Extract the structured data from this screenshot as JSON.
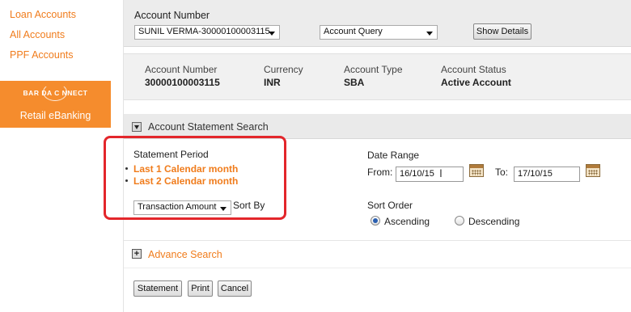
{
  "sidebar": {
    "links": [
      "Loan Accounts",
      "All Accounts",
      "PPF Accounts"
    ],
    "brand_logo": "BAR DA C NNECT",
    "brand_sub": "Retail eBanking"
  },
  "account_bar": {
    "label": "Account Number",
    "account_select": "SUNIL VERMA-30000100003115",
    "query_select": "Account Query",
    "show_details": "Show Details"
  },
  "summary": [
    {
      "header": "Account Number",
      "value": "30000100003115"
    },
    {
      "header": "Currency",
      "value": "INR"
    },
    {
      "header": "Account Type",
      "value": "SBA"
    },
    {
      "header": "Account Status",
      "value": "Active Account"
    }
  ],
  "statement_search": {
    "title": "Account Statement Search",
    "period_label": "Statement Period",
    "period_options": [
      "Last 1 Calendar month",
      "Last 2 Calendar month"
    ],
    "sort_field": "Transaction Amount",
    "sort_by_label": "Sort By",
    "date_range_label": "Date Range",
    "from_label": "From:",
    "from_value": "16/10/15",
    "to_label": "To:",
    "to_value": "17/10/15",
    "sort_order_label": "Sort Order",
    "sort_orders": [
      {
        "label": "Ascending",
        "selected": true
      },
      {
        "label": "Descending",
        "selected": false
      }
    ]
  },
  "advance_search": {
    "icon": "+",
    "label": "Advance Search"
  },
  "buttons": {
    "statement": "Statement",
    "print": "Print",
    "cancel": "Cancel"
  },
  "colors": {
    "accent": "#f07c1c",
    "annotation": "#e3262b",
    "brand": "#f58c2d"
  }
}
